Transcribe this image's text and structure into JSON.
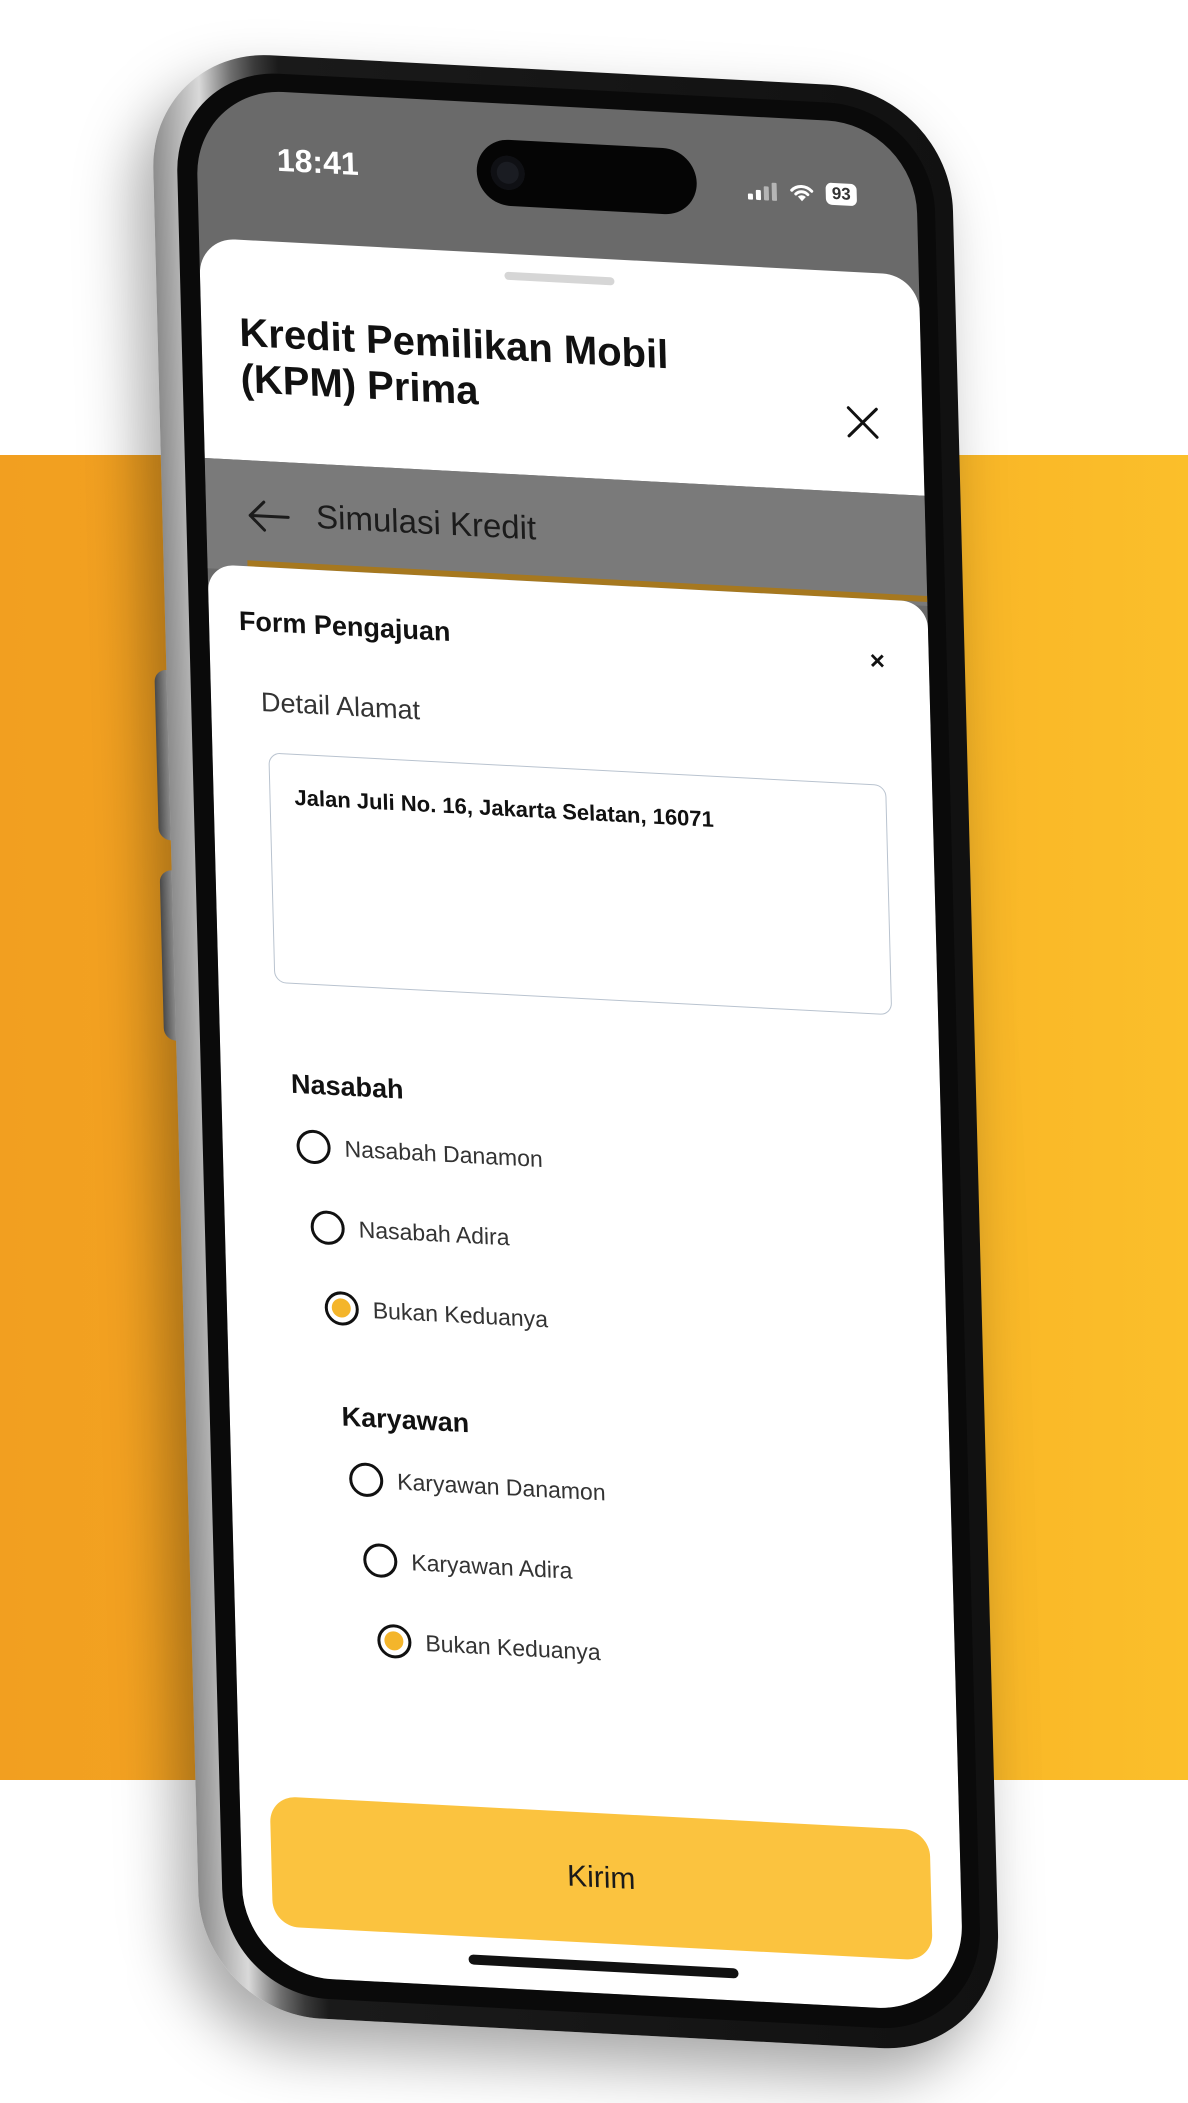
{
  "status_bar": {
    "time": "18:41",
    "battery": "93"
  },
  "sheet": {
    "title": "Kredit Pemilikan Mobil (KPM) Prima"
  },
  "nav": {
    "title": "Simulasi Kredit"
  },
  "form": {
    "title": "Form Pengajuan",
    "close_label": "×",
    "address_label": "Detail Alamat",
    "address_value": "Jalan Juli No. 16, Jakarta  Selatan, 16071",
    "groups": [
      {
        "title": "Nasabah",
        "options": [
          {
            "label": "Nasabah Danamon",
            "checked": false
          },
          {
            "label": "Nasabah Adira",
            "checked": false
          },
          {
            "label": "Bukan Keduanya",
            "checked": true
          }
        ]
      },
      {
        "title": "Karyawan",
        "options": [
          {
            "label": "Karyawan Danamon",
            "checked": false
          },
          {
            "label": "Karyawan Adira",
            "checked": false
          },
          {
            "label": "Bukan Keduanya",
            "checked": true
          }
        ]
      }
    ],
    "submit_label": "Kirim"
  },
  "colors": {
    "background_band": "#f6ab24",
    "accent": "#fbc33f",
    "radio_fill": "#f4b52b"
  }
}
